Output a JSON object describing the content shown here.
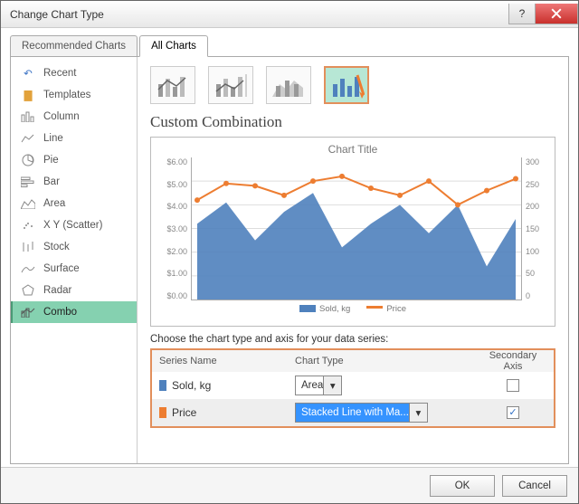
{
  "window": {
    "title": "Change Chart Type"
  },
  "tabs": {
    "recommended": "Recommended Charts",
    "all": "All Charts"
  },
  "sidebar": {
    "items": [
      {
        "label": "Recent"
      },
      {
        "label": "Templates"
      },
      {
        "label": "Column"
      },
      {
        "label": "Line"
      },
      {
        "label": "Pie"
      },
      {
        "label": "Bar"
      },
      {
        "label": "Area"
      },
      {
        "label": "X Y (Scatter)"
      },
      {
        "label": "Stock"
      },
      {
        "label": "Surface"
      },
      {
        "label": "Radar"
      },
      {
        "label": "Combo"
      }
    ]
  },
  "main": {
    "subtitle": "Custom Combination",
    "chart_title": "Chart Title",
    "choose_label": "Choose the chart type and axis for your data series:",
    "headers": {
      "series": "Series Name",
      "type": "Chart Type",
      "axis": "Secondary Axis"
    },
    "rows": [
      {
        "name": "Sold, kg",
        "type": "Area",
        "secondary": false,
        "color": "#4f81bd"
      },
      {
        "name": "Price",
        "type": "Stacked Line with Ma...",
        "secondary": true,
        "color": "#ed7d31"
      }
    ],
    "legend": {
      "s1": "Sold, kg",
      "s2": "Price"
    }
  },
  "footer": {
    "ok": "OK",
    "cancel": "Cancel"
  },
  "chart_data": {
    "type": "combo",
    "title": "Chart Title",
    "x_count": 12,
    "y_left": {
      "min": 0,
      "max": 6,
      "step": 1,
      "format": "$#.00",
      "ticks": [
        "$0.00",
        "$1.00",
        "$2.00",
        "$3.00",
        "$4.00",
        "$5.00",
        "$6.00"
      ]
    },
    "y_right": {
      "min": 0,
      "max": 300,
      "step": 50,
      "ticks": [
        "0",
        "50",
        "100",
        "150",
        "200",
        "250",
        "300"
      ]
    },
    "series": [
      {
        "name": "Sold, kg",
        "chart": "area",
        "axis": "left",
        "color": "#4f81bd",
        "values": [
          3.2,
          4.1,
          2.5,
          3.7,
          4.5,
          2.2,
          3.2,
          4.0,
          2.8,
          4.0,
          1.4,
          3.4
        ]
      },
      {
        "name": "Price",
        "chart": "line-markers",
        "axis": "right",
        "color": "#ed7d31",
        "values": [
          210,
          245,
          240,
          220,
          250,
          260,
          235,
          220,
          250,
          200,
          230,
          255
        ]
      }
    ]
  }
}
